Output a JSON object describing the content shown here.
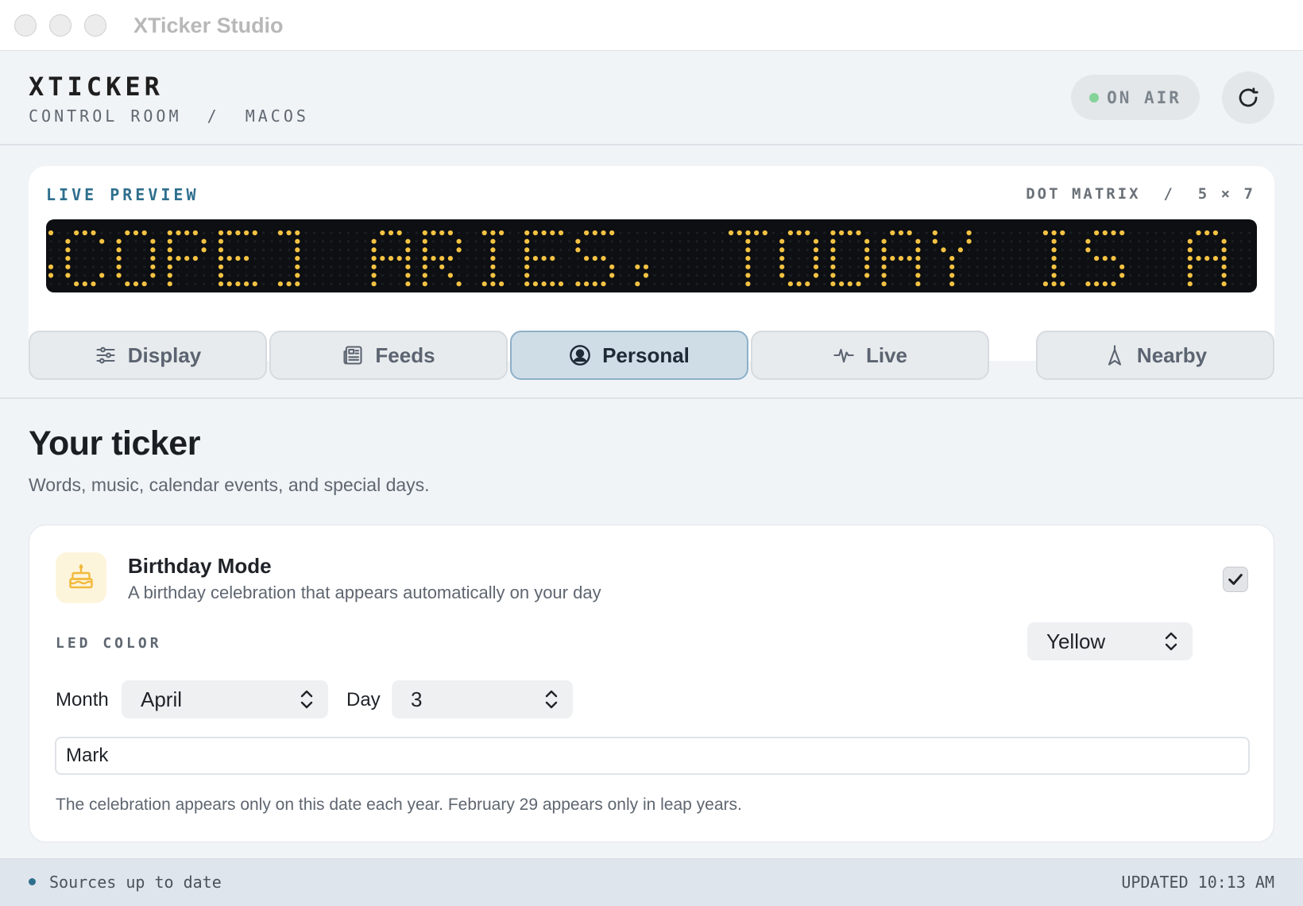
{
  "window": {
    "title": "XTicker Studio"
  },
  "header": {
    "brand": "XTICKER",
    "crumb": "CONTROL ROOM  /  MACOS",
    "status": "ON AIR",
    "status_color": "#86d39a",
    "refresh_icon": "refresh-icon"
  },
  "preview": {
    "label": "LIVE PREVIEW",
    "spec": "DOT MATRIX  /  5 × 7",
    "ticker_text": "SCOPE] ARIES, TODAY IS A GOOD",
    "led_color": "#f5c343"
  },
  "tabs": [
    {
      "label": "Display",
      "icon": "sliders-icon",
      "active": false
    },
    {
      "label": "Feeds",
      "icon": "newspaper-icon",
      "active": false
    },
    {
      "label": "Personal",
      "icon": "user-circle-icon",
      "active": true
    },
    {
      "label": "Live",
      "icon": "activity-icon",
      "active": false
    },
    {
      "label": "Nearby",
      "icon": "location-arrow-icon",
      "active": false
    }
  ],
  "section": {
    "title": "Your ticker",
    "subtitle": "Words, music, calendar events, and special days."
  },
  "birthday": {
    "icon": "cake-icon",
    "title": "Birthday Mode",
    "description": "A birthday celebration that appears automatically on your day",
    "enabled": true,
    "led_color_label": "LED COLOR",
    "led_color_value": "Yellow",
    "led_color_swatch": "#f5c343",
    "month_label": "Month",
    "month_value": "April",
    "day_label": "Day",
    "day_value": "3",
    "name_value": "Mark",
    "note": "The celebration appears only on this date each year. February 29 appears only in leap years."
  },
  "statusbar": {
    "text": "Sources up to date",
    "updated": "UPDATED 10:13 AM"
  }
}
